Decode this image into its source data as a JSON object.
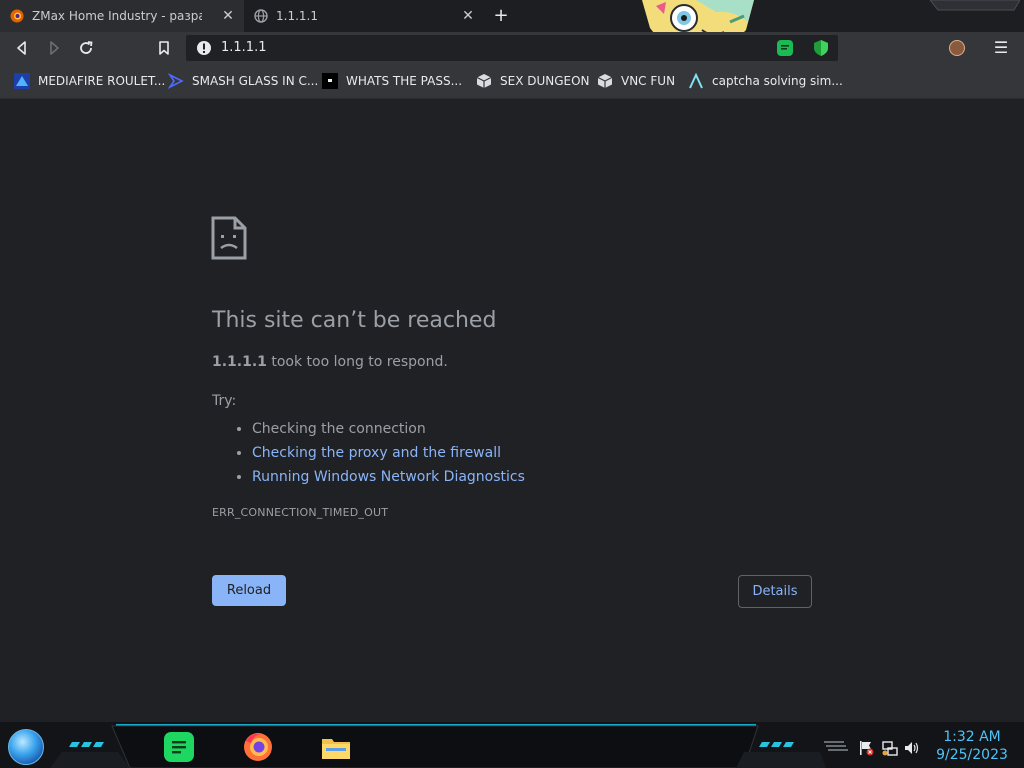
{
  "colors": {
    "page_bg": "#202124",
    "text_muted": "#9aa0a6",
    "link": "#8ab4f8",
    "toolbar_bg": "#35363a",
    "taskbar_accent": "#1aa7c9",
    "clock": "#4fc3f7"
  },
  "tabs": [
    {
      "title": "ZMax Home Industry - разработк",
      "icon": "firefox-icon",
      "active": true
    },
    {
      "title": "1.1.1.1",
      "icon": "globe-icon",
      "active": false
    }
  ],
  "toolbar": {
    "url": "1.1.1.1",
    "security_icon": "info-warning-icon"
  },
  "bookmarks": [
    {
      "label": "MEDIAFIRE ROULET...",
      "icon": "mediafire-icon"
    },
    {
      "label": "SMASH GLASS IN C...",
      "icon": "arrow-bookmark-icon"
    },
    {
      "label": "WHATS THE PASS...",
      "icon": "black-square-icon"
    },
    {
      "label": "SEX DUNGEON",
      "icon": "cube-icon"
    },
    {
      "label": "VNC FUN",
      "icon": "cube-icon"
    },
    {
      "label": "captcha solving sim...",
      "icon": "lambda-icon"
    }
  ],
  "error": {
    "title": "This site can’t be reached",
    "host": "1.1.1.1",
    "message": " took too long to respond.",
    "try_label": "Try:",
    "suggestions": [
      {
        "text": "Checking the connection",
        "link": false
      },
      {
        "text": "Checking the proxy and the firewall",
        "link": true
      },
      {
        "text": "Running Windows Network Diagnostics",
        "link": true
      }
    ],
    "code": "ERR_CONNECTION_TIMED_OUT",
    "reload_label": "Reload",
    "details_label": "Details"
  },
  "taskbar": {
    "time": "1:32 AM",
    "date": "9/25/2023",
    "apps": [
      "spotify-icon",
      "firefox-icon",
      "file-explorer-icon"
    ]
  }
}
